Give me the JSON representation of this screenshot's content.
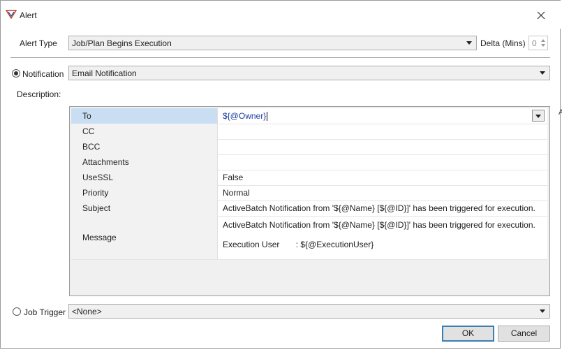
{
  "window": {
    "title": "Alert",
    "edge_glyph": "A"
  },
  "alert_type": {
    "label": "Alert Type",
    "value": "Job/Plan Begins Execution"
  },
  "delta": {
    "label": "Delta (Mins)",
    "value": "0"
  },
  "notification": {
    "label": "Notification",
    "value": "Email Notification",
    "selected": true
  },
  "description": {
    "label": "Description:"
  },
  "properties": {
    "rows": [
      {
        "key": "To",
        "value": "${@Owner}"
      },
      {
        "key": "CC",
        "value": ""
      },
      {
        "key": "BCC",
        "value": ""
      },
      {
        "key": "Attachments",
        "value": ""
      },
      {
        "key": "UseSSL",
        "value": "False"
      },
      {
        "key": "Priority",
        "value": "Normal"
      },
      {
        "key": "Subject",
        "value": "ActiveBatch Notification from '${@Name} [${@ID}]' has been triggered for execution."
      },
      {
        "key": "Message",
        "value_line1": "ActiveBatch Notification from  '${@Name} [${@ID}]' has been triggered for execution.",
        "value_line2": "Execution User       : ${@ExecutionUser}"
      }
    ]
  },
  "job_trigger": {
    "label": "Job Trigger",
    "value": "<None>",
    "selected": false
  },
  "buttons": {
    "ok": "OK",
    "cancel": "Cancel"
  },
  "icons": {
    "app": "alert-app-icon",
    "close": "close-icon"
  }
}
